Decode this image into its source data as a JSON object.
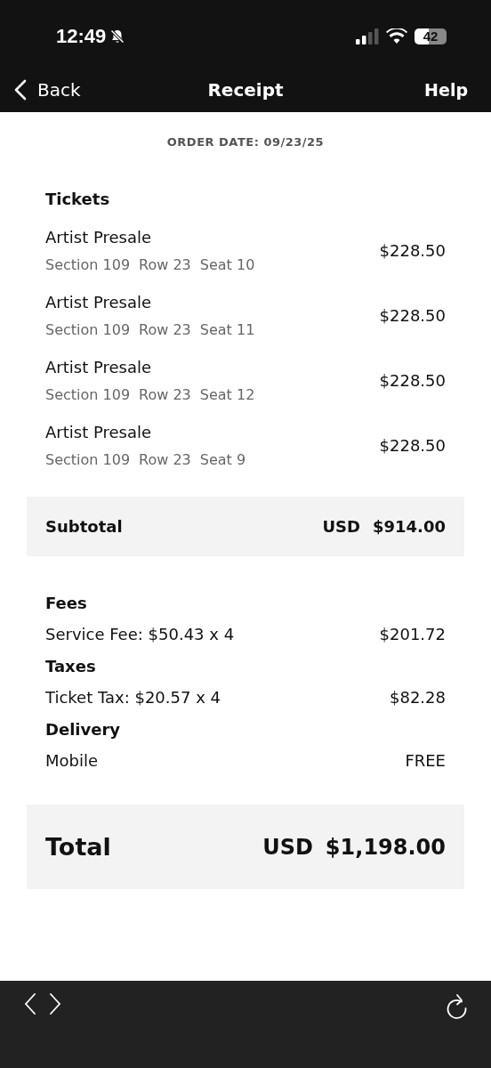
{
  "status_bar": {
    "time": "12:49",
    "battery": "42"
  },
  "nav": {
    "back": "Back",
    "title": "Receipt",
    "help": "Help"
  },
  "order_date": "ORDER DATE: 09/23/25",
  "tickets": {
    "heading": "Tickets",
    "items": [
      {
        "name": "Artist Presale",
        "section": "Section 109",
        "row": "Row 23",
        "seat": "Seat 10",
        "price": "$228.50"
      },
      {
        "name": "Artist Presale",
        "section": "Section 109",
        "row": "Row 23",
        "seat": "Seat 11",
        "price": "$228.50"
      },
      {
        "name": "Artist Presale",
        "section": "Section 109",
        "row": "Row 23",
        "seat": "Seat 12",
        "price": "$228.50"
      },
      {
        "name": "Artist Presale",
        "section": "Section 109",
        "row": "Row 23",
        "seat": "Seat 9",
        "price": "$228.50"
      }
    ]
  },
  "subtotal": {
    "label": "Subtotal",
    "currency": "USD",
    "amount": "$914.00"
  },
  "charges": [
    {
      "heading": "Fees",
      "label": "Service Fee: $50.43 x 4",
      "amount": "$201.72"
    },
    {
      "heading": "Taxes",
      "label": "Ticket Tax: $20.57 x 4",
      "amount": "$82.28"
    },
    {
      "heading": "Delivery",
      "label": "Mobile",
      "amount": "FREE"
    }
  ],
  "total": {
    "label": "Total",
    "currency": "USD",
    "amount": "$1,198.00"
  }
}
